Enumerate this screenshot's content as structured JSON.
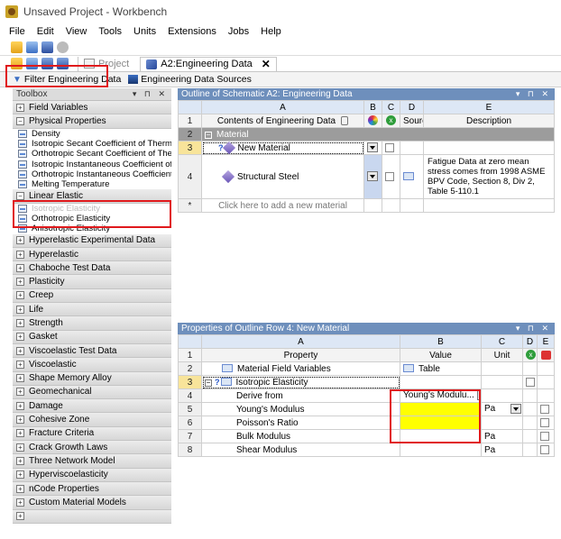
{
  "window": {
    "title": "Unsaved Project - Workbench"
  },
  "menubar": {
    "items": [
      "File",
      "Edit",
      "View",
      "Tools",
      "Units",
      "Extensions",
      "Jobs",
      "Help"
    ]
  },
  "tabs": {
    "project": "Project",
    "active": "A2:Engineering Data",
    "close": "✕"
  },
  "toolbar2": {
    "filter": "Filter Engineering Data",
    "sources": "Engineering Data Sources"
  },
  "toolbox": {
    "title": "Toolbox",
    "categories": [
      {
        "label": "Field Variables",
        "expanded": false
      },
      {
        "label": "Physical Properties",
        "expanded": true,
        "items": [
          "Density",
          "Isotropic Secant Coefficient of Thermal Ex",
          "Orthotropic Secant Coefficient of Therma",
          "Isotropic Instantaneous Coefficient of Th",
          "Orthotropic Instantaneous Coefficient of",
          "Melting Temperature"
        ]
      },
      {
        "label": "Linear Elastic",
        "expanded": true,
        "items": [
          "Isotropic Elasticity",
          "Orthotropic Elasticity",
          "Anisotropic Elasticity"
        ]
      },
      {
        "label": "Hyperelastic Experimental Data"
      },
      {
        "label": "Hyperelastic"
      },
      {
        "label": "Chaboche Test Data"
      },
      {
        "label": "Plasticity"
      },
      {
        "label": "Creep"
      },
      {
        "label": "Life"
      },
      {
        "label": "Strength"
      },
      {
        "label": "Gasket"
      },
      {
        "label": "Viscoelastic Test Data"
      },
      {
        "label": "Viscoelastic"
      },
      {
        "label": "Shape Memory Alloy"
      },
      {
        "label": "Geomechanical"
      },
      {
        "label": "Damage"
      },
      {
        "label": "Cohesive Zone"
      },
      {
        "label": "Fracture Criteria"
      },
      {
        "label": "Crack Growth Laws"
      },
      {
        "label": "Three Network Model"
      },
      {
        "label": "Hyperviscoelasticity"
      },
      {
        "label": "nCode Properties"
      },
      {
        "label": "Custom Material Models"
      }
    ]
  },
  "outline": {
    "title": "Outline of Schematic A2: Engineering Data",
    "columns": [
      "A",
      "B",
      "C",
      "D",
      "E"
    ],
    "headers": {
      "contents": "Contents of Engineering Data",
      "source": "Source",
      "description": "Description"
    },
    "rows": {
      "r1": "1",
      "r2": "2",
      "r3": "3",
      "r4": "4",
      "rstar": "*",
      "section": "Material",
      "new_material": "New Material",
      "structural_steel": "Structural Steel",
      "steel_desc": "Fatigue Data at zero mean stress comes from 1998 ASME BPV Code, Section 8, Div 2, Table 5-110.1",
      "add_new": "Click here to add a new material"
    }
  },
  "properties": {
    "title": "Properties of Outline Row 4: New Material",
    "columns": [
      "A",
      "B",
      "C",
      "D",
      "E"
    ],
    "headers": {
      "property": "Property",
      "value": "Value",
      "unit": "Unit"
    },
    "rows": [
      {
        "n": "1"
      },
      {
        "n": "2",
        "property": "Material Field Variables",
        "value": "Table"
      },
      {
        "n": "3",
        "property": "Isotropic Elasticity"
      },
      {
        "n": "4",
        "property": "Derive from",
        "value": "Young's Modulu..."
      },
      {
        "n": "5",
        "property": "Young's Modulus",
        "unit": "Pa"
      },
      {
        "n": "6",
        "property": "Poisson's Ratio"
      },
      {
        "n": "7",
        "property": "Bulk Modulus",
        "unit": "Pa"
      },
      {
        "n": "8",
        "property": "Shear Modulus",
        "unit": "Pa"
      }
    ]
  },
  "colors": {
    "highlight": "#e0191c",
    "header_blue": "#6e8fbc",
    "input_yellow": "#ffff00"
  }
}
